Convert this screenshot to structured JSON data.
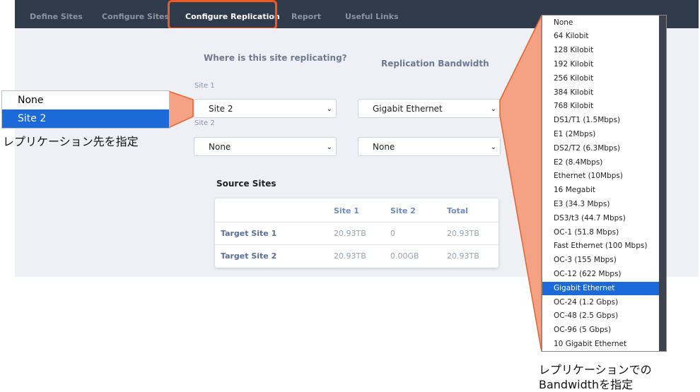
{
  "nav": {
    "tabs": [
      {
        "label": "Define Sites",
        "active": false
      },
      {
        "label": "Configure Sites",
        "active": false
      },
      {
        "label": "Configure Replication",
        "active": true
      },
      {
        "label": "Report",
        "active": false
      },
      {
        "label": "Useful Links",
        "active": false
      }
    ]
  },
  "replication": {
    "heading": "Where is this site replicating?",
    "site1_label": "Site 1",
    "site1_value": "Site 2",
    "site2_label": "Site 2",
    "site2_value": "None"
  },
  "bandwidth": {
    "heading": "Replication Bandwidth",
    "site1_value": "Gigabit Ethernet",
    "site2_value": "None"
  },
  "source_sites": {
    "title": "Source Sites",
    "columns": [
      "Site 1",
      "Site 2",
      "Total"
    ],
    "rows": [
      {
        "name": "Target Site 1",
        "site1": "20.93TB",
        "site2": "0",
        "total": "20.93TB"
      },
      {
        "name": "Target Site 2",
        "site1": "20.93TB",
        "site2": "0.00GB",
        "total": "20.93TB"
      }
    ]
  },
  "site_dropdown": {
    "options": [
      "None",
      "Site 2"
    ],
    "selected": "Site 2",
    "caption": "レプリケーション先を指定"
  },
  "bandwidth_dropdown": {
    "options": [
      "None",
      "64 Kilobit",
      "128 Kilobit",
      "192 Kilobit",
      "256 Kilobit",
      "384 Kilobit",
      "768 Kilobit",
      "DS1/T1 (1.5Mbps)",
      "E1 (2Mbps)",
      "DS2/T2 (6.3Mbps)",
      "E2 (8.4Mbps)",
      "Ethernet (10Mbps)",
      "16 Megabit",
      "E3 (34.3 Mbps)",
      "DS3/t3 (44.7 Mbps)",
      "OC-1 (51.8 Mbps)",
      "Fast Ethernet (100 Mbps)",
      "OC-3 (155 Mbps)",
      "OC-12 (622 Mbps)",
      "Gigabit Ethernet",
      "OC-24 (1.2 Gbps)",
      "OC-48 (2.5 Gbps)",
      "OC-96 (5 Gbps)",
      "10 Gigabit Ethernet"
    ],
    "selected": "Gigabit Ethernet",
    "caption_line1": "レプリケーションでの",
    "caption_line2": "Bandwidthを指定"
  },
  "colors": {
    "nav_bg": "#2f3a4b",
    "highlight": "#f05a1f",
    "callout_fill": "#f5a183",
    "selected_bg": "#1c6ad9"
  }
}
